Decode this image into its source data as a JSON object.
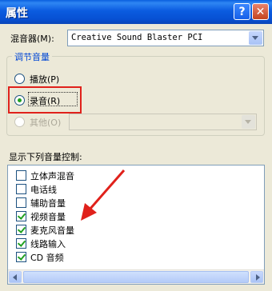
{
  "window": {
    "title": "属性",
    "help_label": "?",
    "close_label": "✕"
  },
  "mixer": {
    "label": "混音器(M):",
    "value": "Creative Sound Blaster PCI"
  },
  "adjust_group": {
    "title": "调节音量",
    "playback_label": "播放(P)",
    "record_label": "录音(R)",
    "other_label": "其他(O)",
    "selected": "record"
  },
  "controls": {
    "label": "显示下列音量控制:",
    "items": [
      {
        "label": "立体声混音",
        "checked": false
      },
      {
        "label": "电话线",
        "checked": false
      },
      {
        "label": "辅助音量",
        "checked": false
      },
      {
        "label": "视频音量",
        "checked": true
      },
      {
        "label": "麦克风音量",
        "checked": true
      },
      {
        "label": "线路输入",
        "checked": true
      },
      {
        "label": "CD 音频",
        "checked": true
      }
    ]
  },
  "annotation": {
    "box_color": "#e0211b",
    "arrow_color": "#e0211b"
  },
  "colors": {
    "titlebar": "#0a5fde",
    "dialog_bg": "#ece9d8",
    "group_title": "#0046d5"
  }
}
